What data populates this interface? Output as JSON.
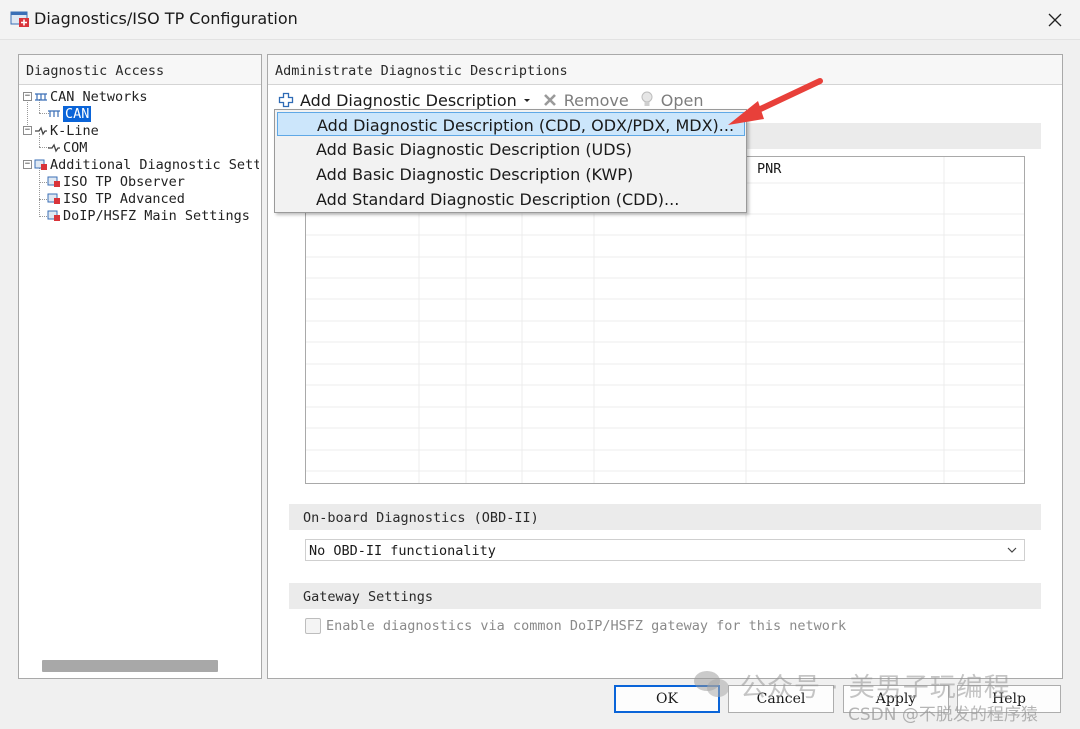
{
  "window": {
    "title": "Diagnostics/ISO TP Configuration"
  },
  "left_panel": {
    "header": "Diagnostic Access",
    "tree": [
      {
        "label": "CAN Networks",
        "expander": "−",
        "icon": "network-icon",
        "level": 0
      },
      {
        "label": "CAN",
        "icon": "network-icon",
        "level": 1,
        "selected": true
      },
      {
        "label": "K-Line",
        "expander": "−",
        "icon": "kline-icon",
        "level": 0
      },
      {
        "label": "COM",
        "icon": "kline-icon",
        "level": 1
      },
      {
        "label": "Additional Diagnostic Setti",
        "expander": "−",
        "icon": "settings-icon",
        "level": 0
      },
      {
        "label": "ISO TP Observer",
        "icon": "settings-icon",
        "level": 1
      },
      {
        "label": "ISO TP Advanced",
        "icon": "settings-icon",
        "level": 1
      },
      {
        "label": "DoIP/HSFZ Main Settings",
        "icon": "settings-icon",
        "level": 1
      }
    ]
  },
  "right_panel": {
    "header": "Administrate Diagnostic Descriptions",
    "toolbar": {
      "add_label": "Add Diagnostic Description",
      "remove_label": "Remove",
      "open_label": "Open"
    },
    "grid": {
      "visible_column": "PNR"
    },
    "obd_section": {
      "title": "On-board Diagnostics (OBD-II)",
      "select_value": "No OBD-II functionality"
    },
    "gateway_section": {
      "title": "Gateway Settings",
      "checkbox_label": "Enable diagnostics via common DoIP/HSFZ gateway for this network",
      "checked": false
    }
  },
  "dropdown_menu": {
    "items": [
      {
        "label": "Add Diagnostic Description (CDD, ODX/PDX, MDX)...",
        "highlighted": true
      },
      {
        "label": "Add Basic Diagnostic Description (UDS)",
        "highlighted": false
      },
      {
        "label": "Add Basic Diagnostic Description (KWP)",
        "highlighted": false
      },
      {
        "label": "Add Standard Diagnostic Description (CDD)...",
        "highlighted": false
      }
    ]
  },
  "buttons": {
    "ok": "OK",
    "cancel": "Cancel",
    "apply": "Apply",
    "help": "Help"
  },
  "watermark": {
    "line1": "公众号 · 美男子玩编程",
    "line2": "CSDN @不脱发的程序猿"
  },
  "colors": {
    "selection": "#0a64d8",
    "menu_highlight": "#cce6fb",
    "arrow": "#e8403a"
  }
}
